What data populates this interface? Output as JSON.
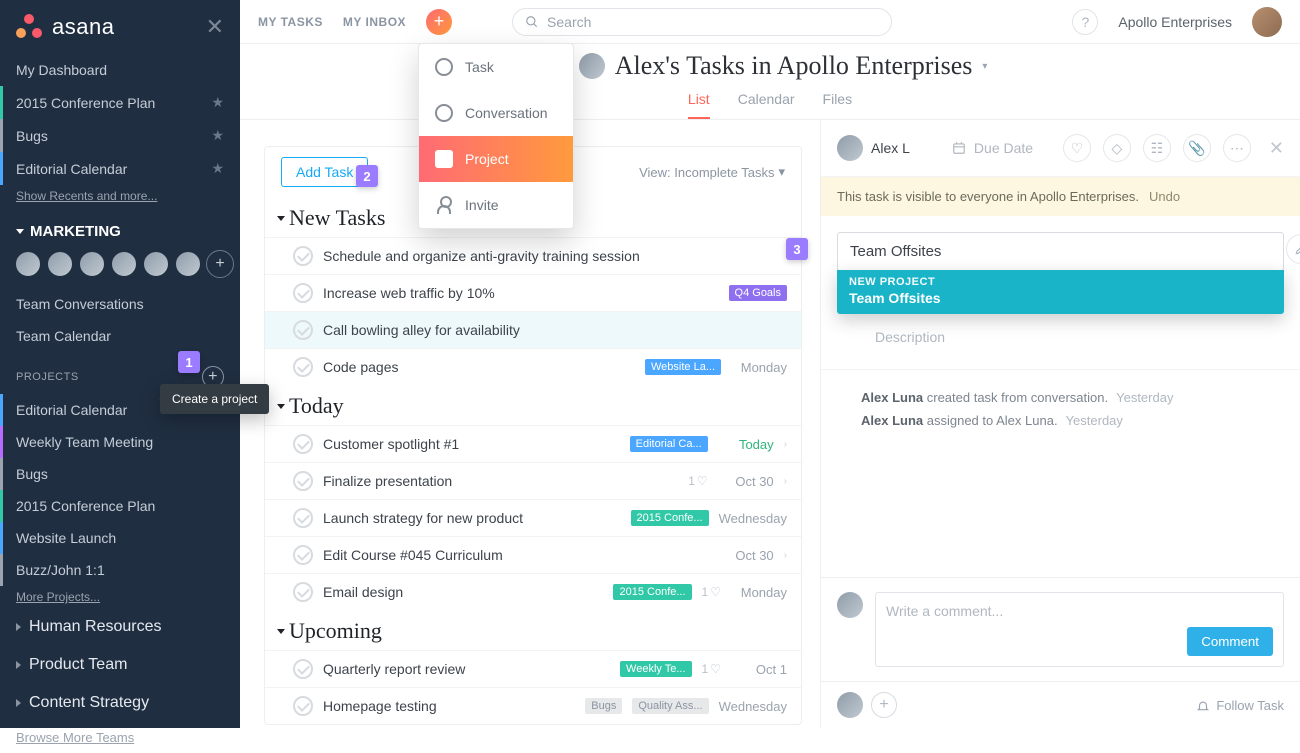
{
  "brand": "asana",
  "topbar": {
    "my_tasks": "MY TASKS",
    "my_inbox": "MY INBOX",
    "search_placeholder": "Search",
    "workspace": "Apollo Enterprises"
  },
  "plus_menu": {
    "task": "Task",
    "conversation": "Conversation",
    "project": "Project",
    "invite": "Invite"
  },
  "sidebar": {
    "dashboard": "My Dashboard",
    "recents": [
      {
        "label": "2015 Conference Plan",
        "color": "green"
      },
      {
        "label": "Bugs",
        "color": "gray"
      },
      {
        "label": "Editorial Calendar",
        "color": "blue"
      }
    ],
    "show_recents": "Show Recents and more...",
    "team_name": "MARKETING",
    "team_conversations": "Team Conversations",
    "team_calendar": "Team Calendar",
    "projects_label": "PROJECTS",
    "projects": [
      {
        "label": "Editorial Calendar",
        "color": "blue"
      },
      {
        "label": "Weekly Team Meeting",
        "color": "purple"
      },
      {
        "label": "Bugs",
        "color": "gray"
      },
      {
        "label": "2015 Conference Plan",
        "color": "green"
      },
      {
        "label": "Website Launch",
        "color": "blue"
      },
      {
        "label": "Buzz/John 1:1",
        "color": "gray"
      }
    ],
    "more_projects": "More Projects...",
    "other_teams": [
      "Human Resources",
      "Product Team",
      "Content Strategy"
    ],
    "browse_teams": "Browse More Teams",
    "create_project_tooltip": "Create a project"
  },
  "page": {
    "title": "Alex's Tasks in Apollo Enterprises",
    "tabs": {
      "list": "List",
      "calendar": "Calendar",
      "files": "Files"
    }
  },
  "tasks": {
    "add_task": "Add Task",
    "view_label": "View: Incomplete Tasks",
    "sections": {
      "new": "New Tasks",
      "today": "Today",
      "upcoming": "Upcoming"
    },
    "new_tasks": [
      {
        "title": "Schedule and organize anti-gravity training session"
      },
      {
        "title": "Increase web traffic by 10%",
        "tag": "Q4 Goals",
        "tag_color": "purple"
      },
      {
        "title": "Call bowling alley for availability",
        "selected": true
      },
      {
        "title": "Code pages",
        "tag": "Website La...",
        "tag_color": "blue",
        "date": "Monday"
      }
    ],
    "today_tasks": [
      {
        "title": "Customer spotlight #1",
        "tag": "Editorial Ca...",
        "tag_color": "blue",
        "date": "Today",
        "today": true
      },
      {
        "title": "Finalize presentation",
        "likes": "1",
        "date": "Oct 30"
      },
      {
        "title": "Launch strategy for new product",
        "tag": "2015 Confe...",
        "tag_color": "teal",
        "date": "Wednesday"
      },
      {
        "title": "Edit Course #045 Curriculum",
        "date": "Oct 30"
      },
      {
        "title": "Email design",
        "tag": "2015 Confe...",
        "tag_color": "teal",
        "likes": "1",
        "date": "Monday"
      }
    ],
    "upcoming_tasks": [
      {
        "title": "Quarterly report review",
        "tag": "Weekly Te...",
        "tag_color": "teal",
        "likes": "1",
        "date": "Oct 1"
      },
      {
        "title": "Homepage testing",
        "tags_gray": [
          "Bugs",
          "Quality Ass..."
        ],
        "date": "Wednesday"
      }
    ]
  },
  "detail": {
    "assignee": "Alex L",
    "due_placeholder": "Due Date",
    "visibility_msg": "This task is visible to everyone in Apollo Enterprises.",
    "undo": "Undo",
    "project_value": "Team Offsites",
    "dropdown_header": "NEW PROJECT",
    "dropdown_option": "Team Offsites",
    "description_placeholder": "Description",
    "activity": [
      {
        "who": "Alex Luna",
        "what": " created task from conversation.",
        "when": "Yesterday"
      },
      {
        "who": "Alex Luna",
        "what": " assigned to Alex Luna.",
        "when": "Yesterday"
      }
    ],
    "comment_placeholder": "Write a comment...",
    "comment_btn": "Comment",
    "follow": "Follow Task"
  },
  "callouts": {
    "c1": "1",
    "c2": "2",
    "c3": "3"
  }
}
